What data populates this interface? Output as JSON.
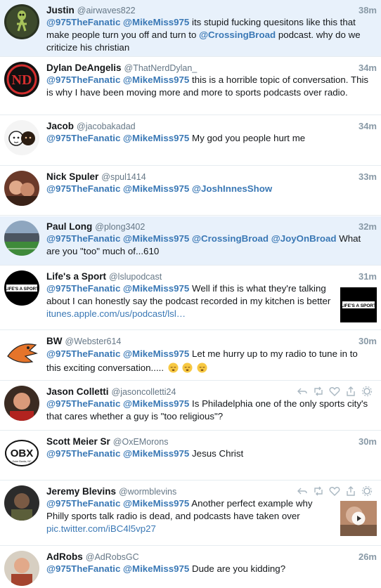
{
  "tweets": [
    {
      "name": "Justin",
      "handle": "@airwaves822",
      "time": "38m",
      "mentions": [
        "@975TheFanatic",
        "@MikeMiss975"
      ],
      "text": "its stupid fucking quesitons like this that make people turn you off and turn to",
      "mention_inline": "@CrossingBroad",
      "text_after": "podcast. why do we criticize his christian"
    },
    {
      "name": "Dylan DeAngelis",
      "handle": "@ThatNerdDylan_",
      "time": "34m",
      "mentions": [
        "@975TheFanatic",
        "@MikeMiss975"
      ],
      "text": "this is a horrible topic of conversation. This is why I have been moving more and more to sports podcasts over radio."
    },
    {
      "name": "Jacob",
      "handle": "@jacobakadad",
      "time": "34m",
      "mentions": [
        "@975TheFanatic",
        "@MikeMiss975"
      ],
      "text": "My god you people hurt me"
    },
    {
      "name": "Nick Spuler",
      "handle": "@spul1414",
      "time": "33m",
      "mentions": [
        "@975TheFanatic",
        "@MikeMiss975",
        "@JoshInnesShow"
      ],
      "text": ""
    },
    {
      "name": "Paul Long",
      "handle": "@plong3402",
      "time": "32m",
      "mentions": [
        "@975TheFanatic",
        "@MikeMiss975",
        "@CrossingBroad",
        "@JoyOnBroad"
      ],
      "text": "What are you \"too\" much of...610"
    },
    {
      "name": "Life's a Sport",
      "handle": "@lslupodcast",
      "time": "31m",
      "mentions": [
        "@975TheFanatic",
        "@MikeMiss975"
      ],
      "text": "Well if this is what they're talking about I can honestly say the podcast recorded in my kitchen is better",
      "link": "itunes.apple.com/us/podcast/lsl…",
      "avatar_text": "LIFE'S A SPORT",
      "thumb_text": "LIFE'S A SPORT"
    },
    {
      "name": "BW",
      "handle": "@Webster614",
      "time": "30m",
      "mentions": [
        "@975TheFanatic",
        "@MikeMiss975"
      ],
      "text": "Let me hurry up to my radio to tune in to this exciting conversation....."
    },
    {
      "name": "Jason Colletti",
      "handle": "@jasoncolletti24",
      "time": "",
      "mentions": [
        "@975TheFanatic",
        "@MikeMiss975"
      ],
      "text": "Is Philadelphia one of the only sports city's that cares whether a guy is \"too religious\"?"
    },
    {
      "name": "Scott Meier Sr",
      "handle": "@OxEMorons",
      "time": "30m",
      "mentions": [
        "@975TheFanatic",
        "@MikeMiss975"
      ],
      "text": "Jesus Christ",
      "avatar_text": "OBX",
      "avatar_subtext": "Outer Banks, NC"
    },
    {
      "name": "Jeremy Blevins",
      "handle": "@wormblevins",
      "time": "",
      "mentions": [
        "@975TheFanatic",
        "@MikeMiss975"
      ],
      "text": "Another perfect example why Philly sports talk radio is dead, and podcasts have taken over",
      "link": "pic.twitter.com/iBC4l5vp27"
    },
    {
      "name": "AdRobs",
      "handle": "@AdRobsGC",
      "time": "26m",
      "mentions": [
        "@975TheFanatic",
        "@MikeMiss975"
      ],
      "text": "Dude are you kidding?"
    }
  ],
  "colors": {
    "mention": "#3a78b5",
    "highlight_bg": "#e8f1fb",
    "time": "#8899a6"
  },
  "icons": [
    "reply-icon",
    "retweet-icon",
    "like-icon",
    "share-icon",
    "gear-icon",
    "play-icon",
    "sleepy-emoji-icon"
  ]
}
